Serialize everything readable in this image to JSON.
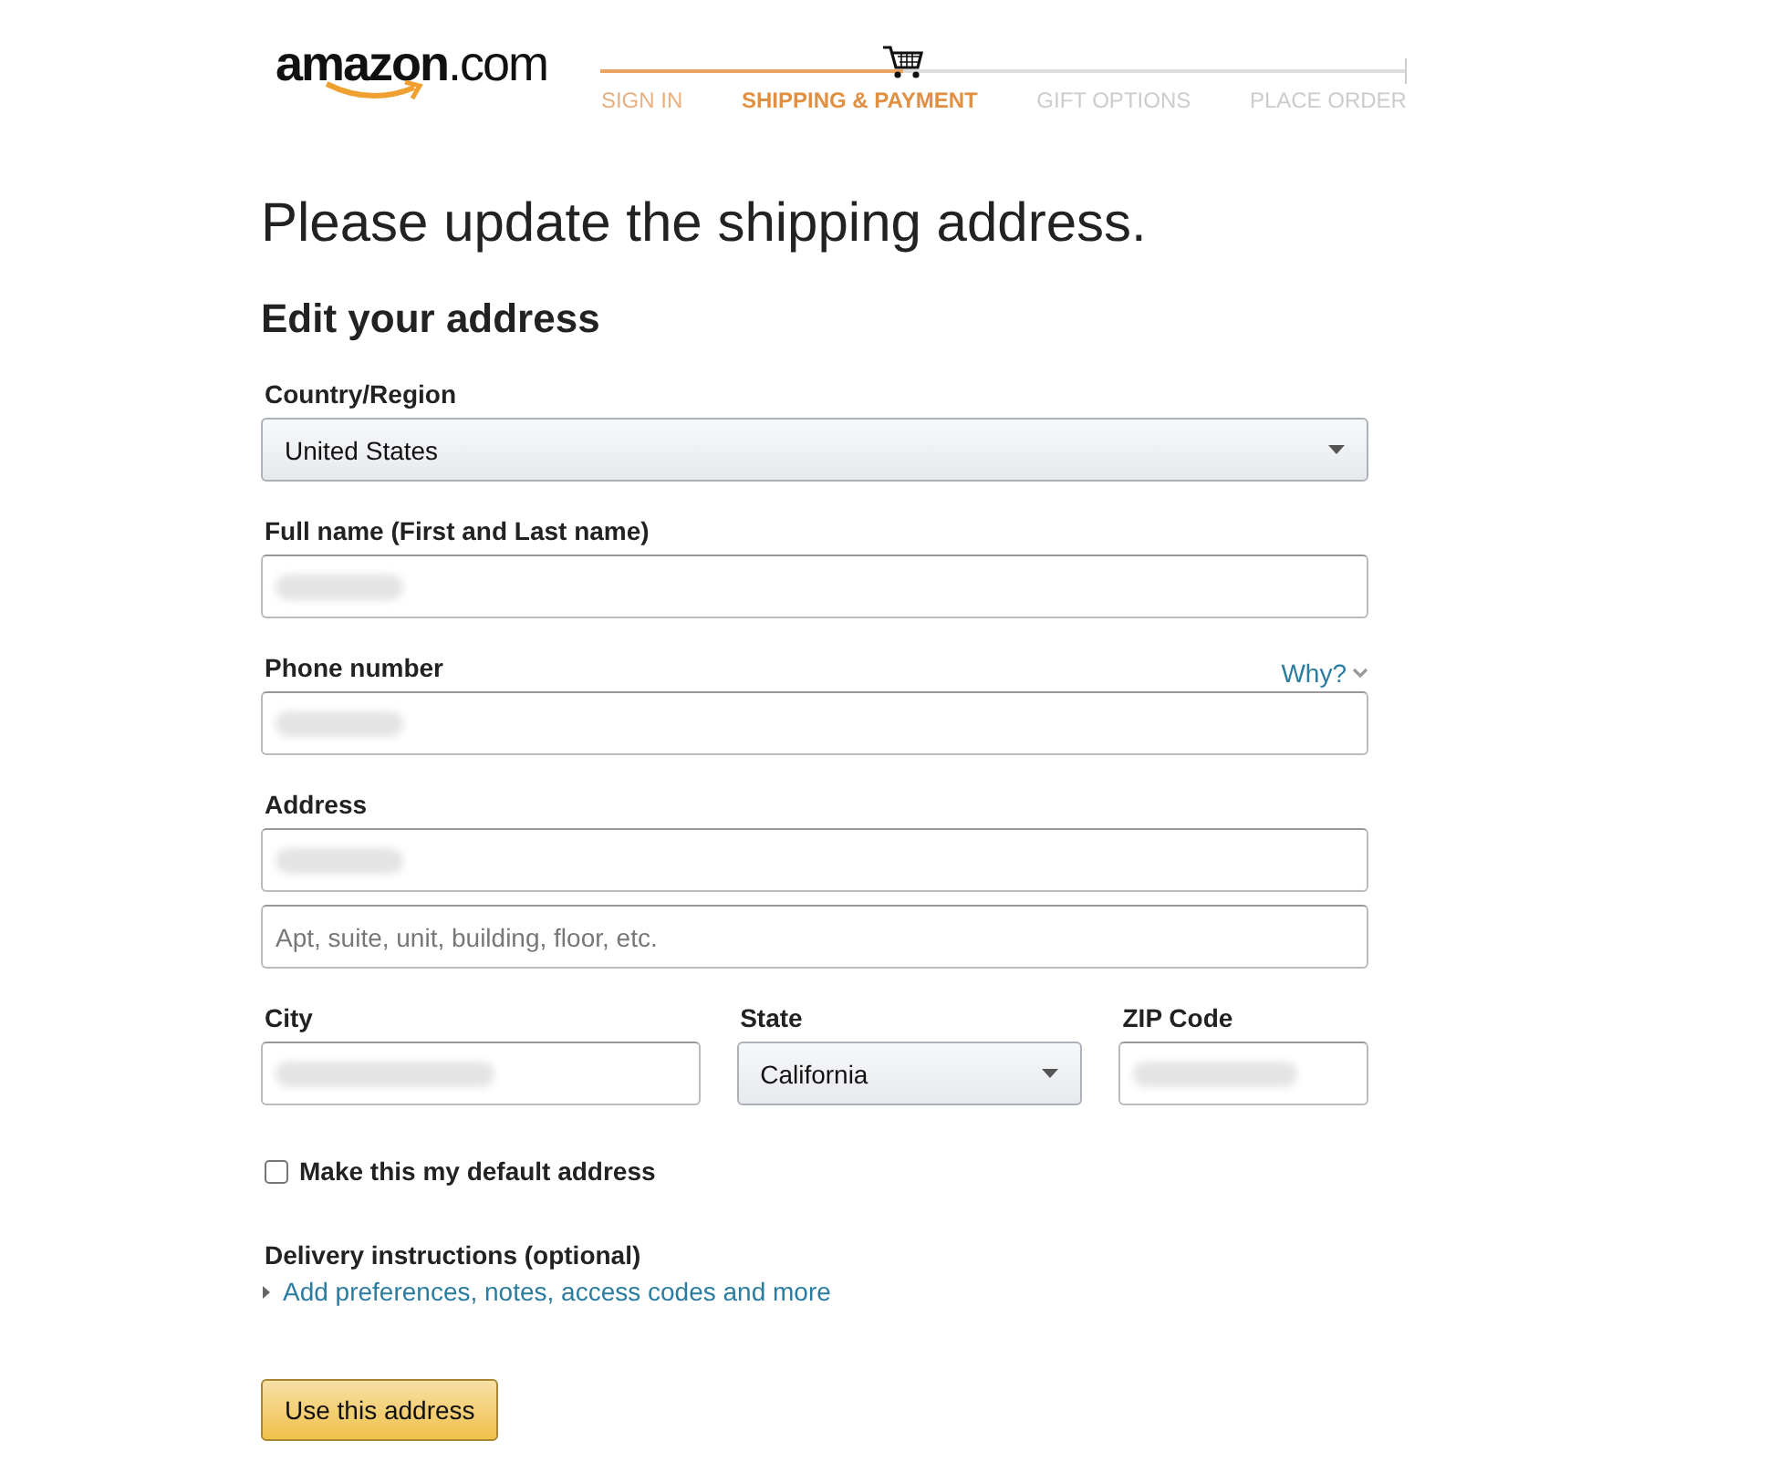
{
  "logo": {
    "text": "amazon",
    "suffix": ".com"
  },
  "steps": [
    {
      "label": "SIGN IN",
      "completed": true,
      "selected": false
    },
    {
      "label": "SHIPPING & PAYMENT",
      "completed": false,
      "selected": true
    },
    {
      "label": "GIFT OPTIONS",
      "completed": false,
      "selected": false
    },
    {
      "label": "PLACE ORDER",
      "completed": false,
      "selected": false
    }
  ],
  "heading": "Please update the shipping address.",
  "subheading": "Edit your address",
  "country": {
    "label": "Country/Region",
    "value": "United States"
  },
  "full_name": {
    "label": "Full name (First and Last name)",
    "redacted": true
  },
  "phone": {
    "label": "Phone number",
    "help_link": "Why?",
    "redacted": true
  },
  "address": {
    "label": "Address",
    "line1_redacted": true,
    "line2_placeholder": "Apt, suite, unit, building, floor, etc."
  },
  "city": {
    "label": "City",
    "redacted": true
  },
  "state": {
    "label": "State",
    "value": "California"
  },
  "zip": {
    "label": "ZIP Code",
    "redacted": true
  },
  "default_address": {
    "label": "Make this my default address",
    "checked": false
  },
  "delivery": {
    "label": "Delivery instructions (optional)",
    "link": "Add preferences, notes, access codes and more",
    "expanded": false
  },
  "submit": "Use this address"
}
